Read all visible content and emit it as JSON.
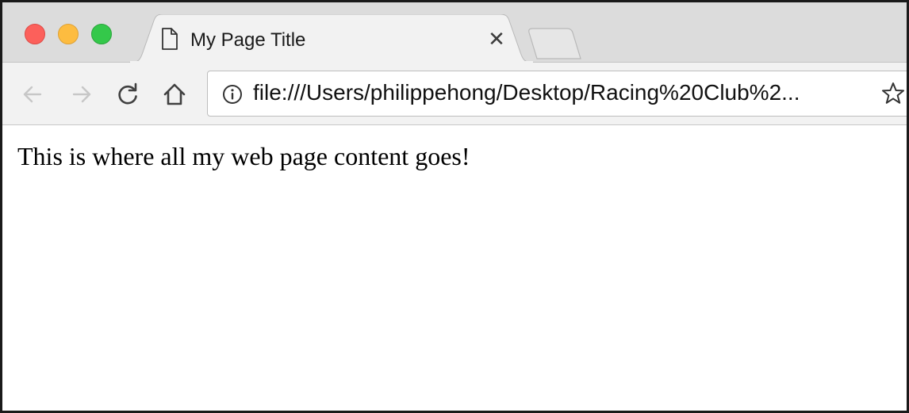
{
  "window": {
    "controls": {
      "close_color": "#fc605b",
      "minimize_color": "#fdbc40",
      "maximize_color": "#34c84a"
    }
  },
  "tabs": [
    {
      "title": "My Page Title",
      "icon": "page-icon",
      "active": true
    }
  ],
  "toolbar": {
    "back_icon": "arrow-left-icon",
    "forward_icon": "arrow-right-icon",
    "reload_icon": "reload-icon",
    "home_icon": "home-icon"
  },
  "address_bar": {
    "url": "file:///Users/philippehong/Desktop/Racing%20Club%2...",
    "security_icon": "info-icon",
    "bookmark_icon": "star-icon"
  },
  "page": {
    "text": "This is where all my web page content goes!"
  }
}
